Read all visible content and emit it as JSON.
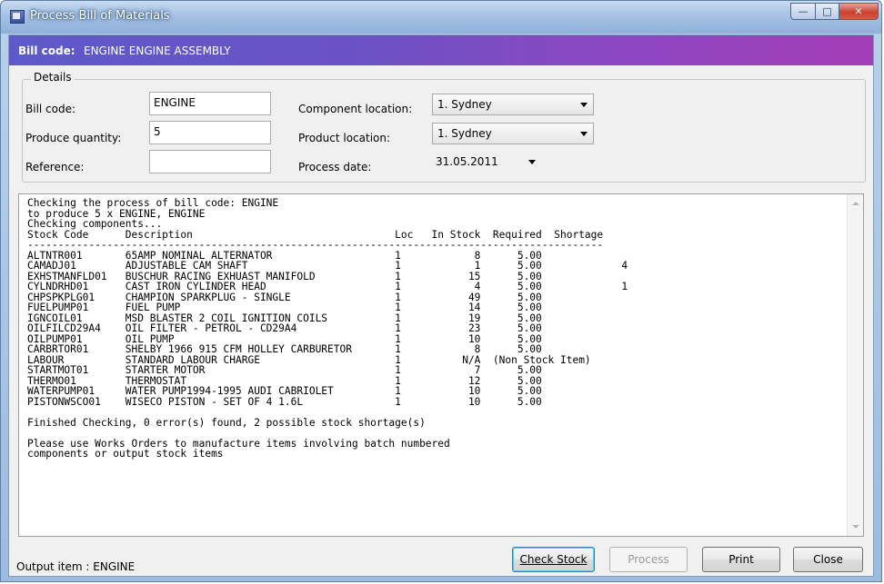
{
  "window": {
    "title": "Process Bill of Materials"
  },
  "header": {
    "label": "Bill code:",
    "value": "ENGINE ENGINE ASSEMBLY"
  },
  "details": {
    "title": "Details",
    "bill_code_label": "Bill code:",
    "bill_code_value": "ENGINE",
    "produce_quantity_label": "Produce quantity:",
    "produce_quantity_value": "5",
    "reference_label": "Reference:",
    "reference_value": "",
    "component_location_label": "Component location:",
    "component_location_value": "1. Sydney",
    "product_location_label": "Product location:",
    "product_location_value": "1. Sydney",
    "process_date_label": "Process date:",
    "process_date_value": "31.05.2011"
  },
  "output": {
    "intro": [
      "Checking the process of bill code: ENGINE",
      "to produce 5 x ENGINE, ENGINE",
      "Checking components..."
    ],
    "columns": [
      "Stock Code",
      "Description",
      "Loc",
      "In Stock",
      "Required",
      "Shortage"
    ],
    "rows": [
      [
        "ALTNTR001",
        "65AMP NOMINAL ALTERNATOR",
        "1",
        "8",
        "5.00",
        ""
      ],
      [
        "CAMADJ01",
        "ADJUSTABLE CAM SHAFT",
        "1",
        "1",
        "5.00",
        "4"
      ],
      [
        "EXHSTMANFLD01",
        "BUSCHUR RACING EXHUAST MANIFOLD",
        "1",
        "15",
        "5.00",
        ""
      ],
      [
        "CYLNDRHD01",
        "CAST IRON CYLINDER HEAD",
        "1",
        "4",
        "5.00",
        "1"
      ],
      [
        "CHPSPKPLG01",
        "CHAMPION SPARKPLUG - SINGLE",
        "1",
        "49",
        "5.00",
        ""
      ],
      [
        "FUELPUMP01",
        "FUEL PUMP",
        "1",
        "14",
        "5.00",
        ""
      ],
      [
        "IGNCOIL01",
        "MSD BLASTER 2 COIL IGNITION COILS",
        "1",
        "19",
        "5.00",
        ""
      ],
      [
        "OILFILCD29A4",
        "OIL FILTER - PETROL - CD29A4",
        "1",
        "23",
        "5.00",
        ""
      ],
      [
        "OILPUMP01",
        "OIL PUMP",
        "1",
        "10",
        "5.00",
        ""
      ],
      [
        "CARBRTOR01",
        "SHELBY 1966 915 CFM HOLLEY CARBURETOR",
        "1",
        "8",
        "5.00",
        ""
      ],
      [
        "LABOUR",
        "STANDARD LABOUR CHARGE",
        "1",
        "N/A",
        "(Non Stock Item)",
        ""
      ],
      [
        "STARTMOT01",
        "STARTER MOTOR",
        "1",
        "7",
        "5.00",
        ""
      ],
      [
        "THERMO01",
        "THERMOSTAT",
        "1",
        "12",
        "5.00",
        ""
      ],
      [
        "WATERPUMP01",
        "WATER PUMP1994-1995 AUDI CABRIOLET",
        "1",
        "10",
        "5.00",
        ""
      ],
      [
        "PISTONWSCO01",
        "WISECO PISTON - SET OF 4 1.6L",
        "1",
        "10",
        "5.00",
        ""
      ]
    ],
    "summary": "Finished Checking, 0 error(s) found, 2 possible stock shortage(s)",
    "note": [
      "Please use Works Orders to manufacture items involving batch numbered",
      "components or output stock items"
    ]
  },
  "footer": {
    "output_item": "Output item : ENGINE",
    "check_stock": "Check Stock",
    "process": "Process",
    "print": "Print",
    "close": "Close"
  }
}
